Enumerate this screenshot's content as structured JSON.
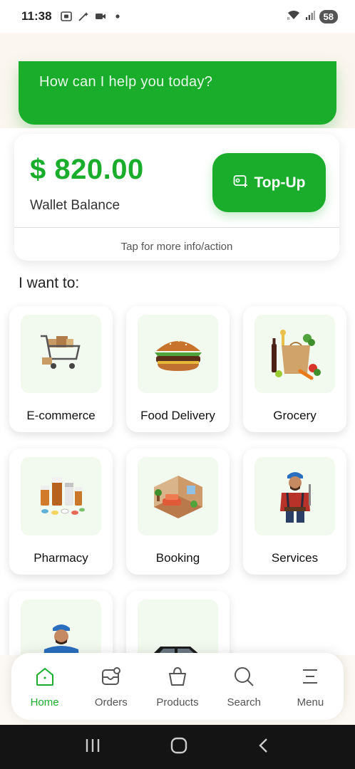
{
  "status_bar": {
    "time": "11:38",
    "battery": "58",
    "icons": [
      "screenshot-icon",
      "magic-wand-icon",
      "video-camera-icon",
      "dot-icon",
      "wifi-icon",
      "signal-icon"
    ]
  },
  "hero": {
    "prompt": "How can I help you today?"
  },
  "wallet": {
    "amount": "$ 820.00",
    "label": "Wallet Balance",
    "topup_label": "Top-Up",
    "hint": "Tap for more info/action"
  },
  "section_title": "I want to:",
  "categories": [
    {
      "label": "E-commerce",
      "icon": "shopping-cart-icon"
    },
    {
      "label": "Food Delivery",
      "icon": "burger-icon"
    },
    {
      "label": "Grocery",
      "icon": "grocery-bag-icon"
    },
    {
      "label": "Pharmacy",
      "icon": "medicine-bottles-icon"
    },
    {
      "label": "Booking",
      "icon": "room-icon"
    },
    {
      "label": "Services",
      "icon": "worker-icon"
    },
    {
      "label": "",
      "icon": "delivery-man-icon"
    },
    {
      "label": "",
      "icon": "car-icon"
    }
  ],
  "bottom_nav": [
    {
      "label": "Home",
      "icon": "home-icon",
      "active": true
    },
    {
      "label": "Orders",
      "icon": "orders-icon",
      "active": false
    },
    {
      "label": "Products",
      "icon": "shopping-bag-icon",
      "active": false
    },
    {
      "label": "Search",
      "icon": "search-icon",
      "active": false
    },
    {
      "label": "Menu",
      "icon": "menu-icon",
      "active": false
    }
  ],
  "colors": {
    "brand_green": "#1aad2c",
    "tile_bg": "#f2f9ee",
    "system_nav_bg": "#141414"
  }
}
